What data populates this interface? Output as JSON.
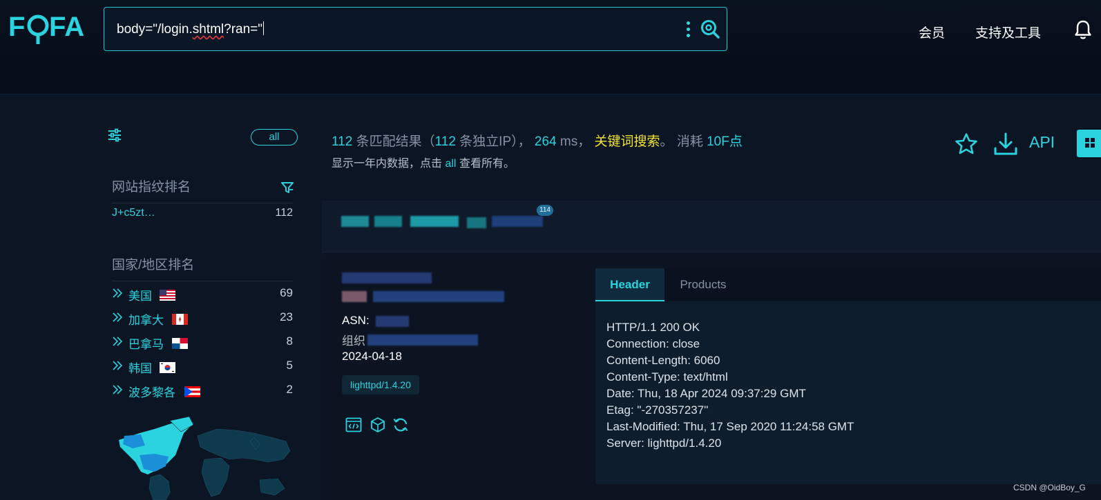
{
  "brand": {
    "logo_text": "FOFA"
  },
  "search": {
    "query_prefix": "body=\"/login.",
    "query_squiggle": "shtml",
    "query_suffix": "?ran=\""
  },
  "nav": {
    "member": "会员",
    "support_tools": "支持及工具"
  },
  "sidebar": {
    "all_label": "all",
    "fingerprint_title": "网站指纹排名",
    "fingerprints": [
      {
        "name": "J+c5zt…",
        "count": "112"
      }
    ],
    "country_title": "国家/地区排名",
    "countries": [
      {
        "name": "美国",
        "count": "69"
      },
      {
        "name": "加拿大",
        "count": "23"
      },
      {
        "name": "巴拿马",
        "count": "8"
      },
      {
        "name": "韩国",
        "count": "5"
      },
      {
        "name": "波多黎各",
        "count": "2"
      }
    ]
  },
  "summary": {
    "results": "112",
    "results_label": "条匹配结果（",
    "unique_ips": "112",
    "unique_ip_label": "条独立IP），",
    "time": "264",
    "time_unit": "ms，",
    "keyword_search": "关键词搜索",
    "period": "。",
    "cost_label": "消耗",
    "cost_value": "10F点",
    "note_prefix": "显示一年内数据，点击",
    "note_link": "all",
    "note_suffix": "查看所有。",
    "api_label": "API"
  },
  "result_header": {
    "badge": "114"
  },
  "result": {
    "asn_label": "ASN:",
    "org_label": "组织",
    "date": "2024-04-18",
    "server_tag": "lighttpd/1.4.20"
  },
  "tabs": {
    "header": "Header",
    "products": "Products"
  },
  "http_header": [
    "HTTP/1.1 200 OK",
    "Connection: close",
    "Content-Length: 6060",
    "Content-Type: text/html",
    "Date: Thu, 18 Apr 2024 09:37:29 GMT",
    "Etag: \"-270357237\"",
    "Last-Modified: Thu, 17 Sep 2020 11:24:58 GMT",
    "Server: lighttpd/1.4.20"
  ],
  "watermark": "CSDN @OidBoy_G",
  "colors": {
    "accent": "#2bd3df",
    "keyword": "#f3e336",
    "background": "#0c1523"
  }
}
